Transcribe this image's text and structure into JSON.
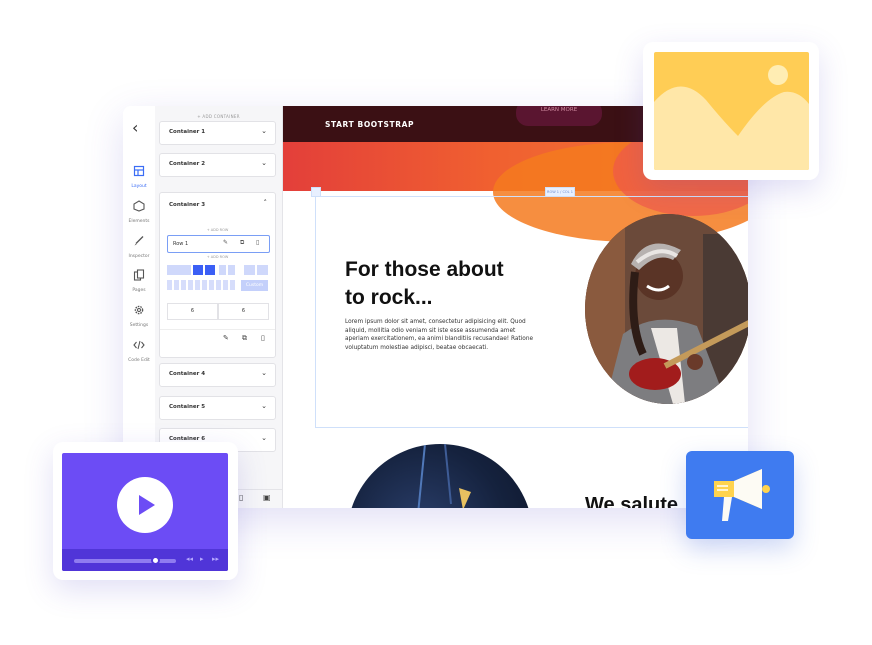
{
  "sidebar": {
    "back_icon": "chevron-left-icon",
    "items": [
      {
        "label": "Layout",
        "icon": "layout-icon",
        "active": true
      },
      {
        "label": "Elements",
        "icon": "elements-icon"
      },
      {
        "label": "Inspector",
        "icon": "brush-icon"
      },
      {
        "label": "Pages",
        "icon": "pages-icon"
      },
      {
        "label": "Settings",
        "icon": "gear-icon"
      },
      {
        "label": "Code Edit",
        "icon": "code-icon"
      }
    ]
  },
  "panel": {
    "add_container_label": "+ ADD CONTAINER",
    "containers": [
      "Container 1",
      "Container 2",
      "Container 3",
      "Container 4",
      "Container 5",
      "Container 6"
    ],
    "expanded": {
      "name": "Container 3",
      "add_row_top": "+ ADD ROW",
      "row_name": "Row 1",
      "add_row_bottom": "+ ADD ROW",
      "custom_label": "Custom",
      "columns": [
        "6",
        "6"
      ]
    }
  },
  "canvas": {
    "brand": "START BOOTSTRAP",
    "cta": "LEARN MORE",
    "section_badge": "ROW 1 / COL 1",
    "headline_line1": "For those about",
    "headline_line2": "to rock...",
    "paragraph": "Lorem ipsum dolor sit amet, consectetur adipisicing elit. Quod aliquid, mollitia odio veniam sit iste esse assumenda amet aperiam exercitationem, ea animi blanditiis recusandae! Ratione voluptatum molestiae adipisci, beatae obcaecati.",
    "teaser": "We salute"
  },
  "cards": {
    "image_icon": "image-placeholder-icon",
    "video_icon": "video-player-icon",
    "announcement_icon": "megaphone-icon"
  },
  "colors": {
    "accent": "#3b5ff5",
    "hero_dark": "#3b1014",
    "hero_orange": "#f06030",
    "image_card": "#ffcd55",
    "video_card": "#6c4cf5",
    "megaphone_card": "#3f7bf0"
  }
}
